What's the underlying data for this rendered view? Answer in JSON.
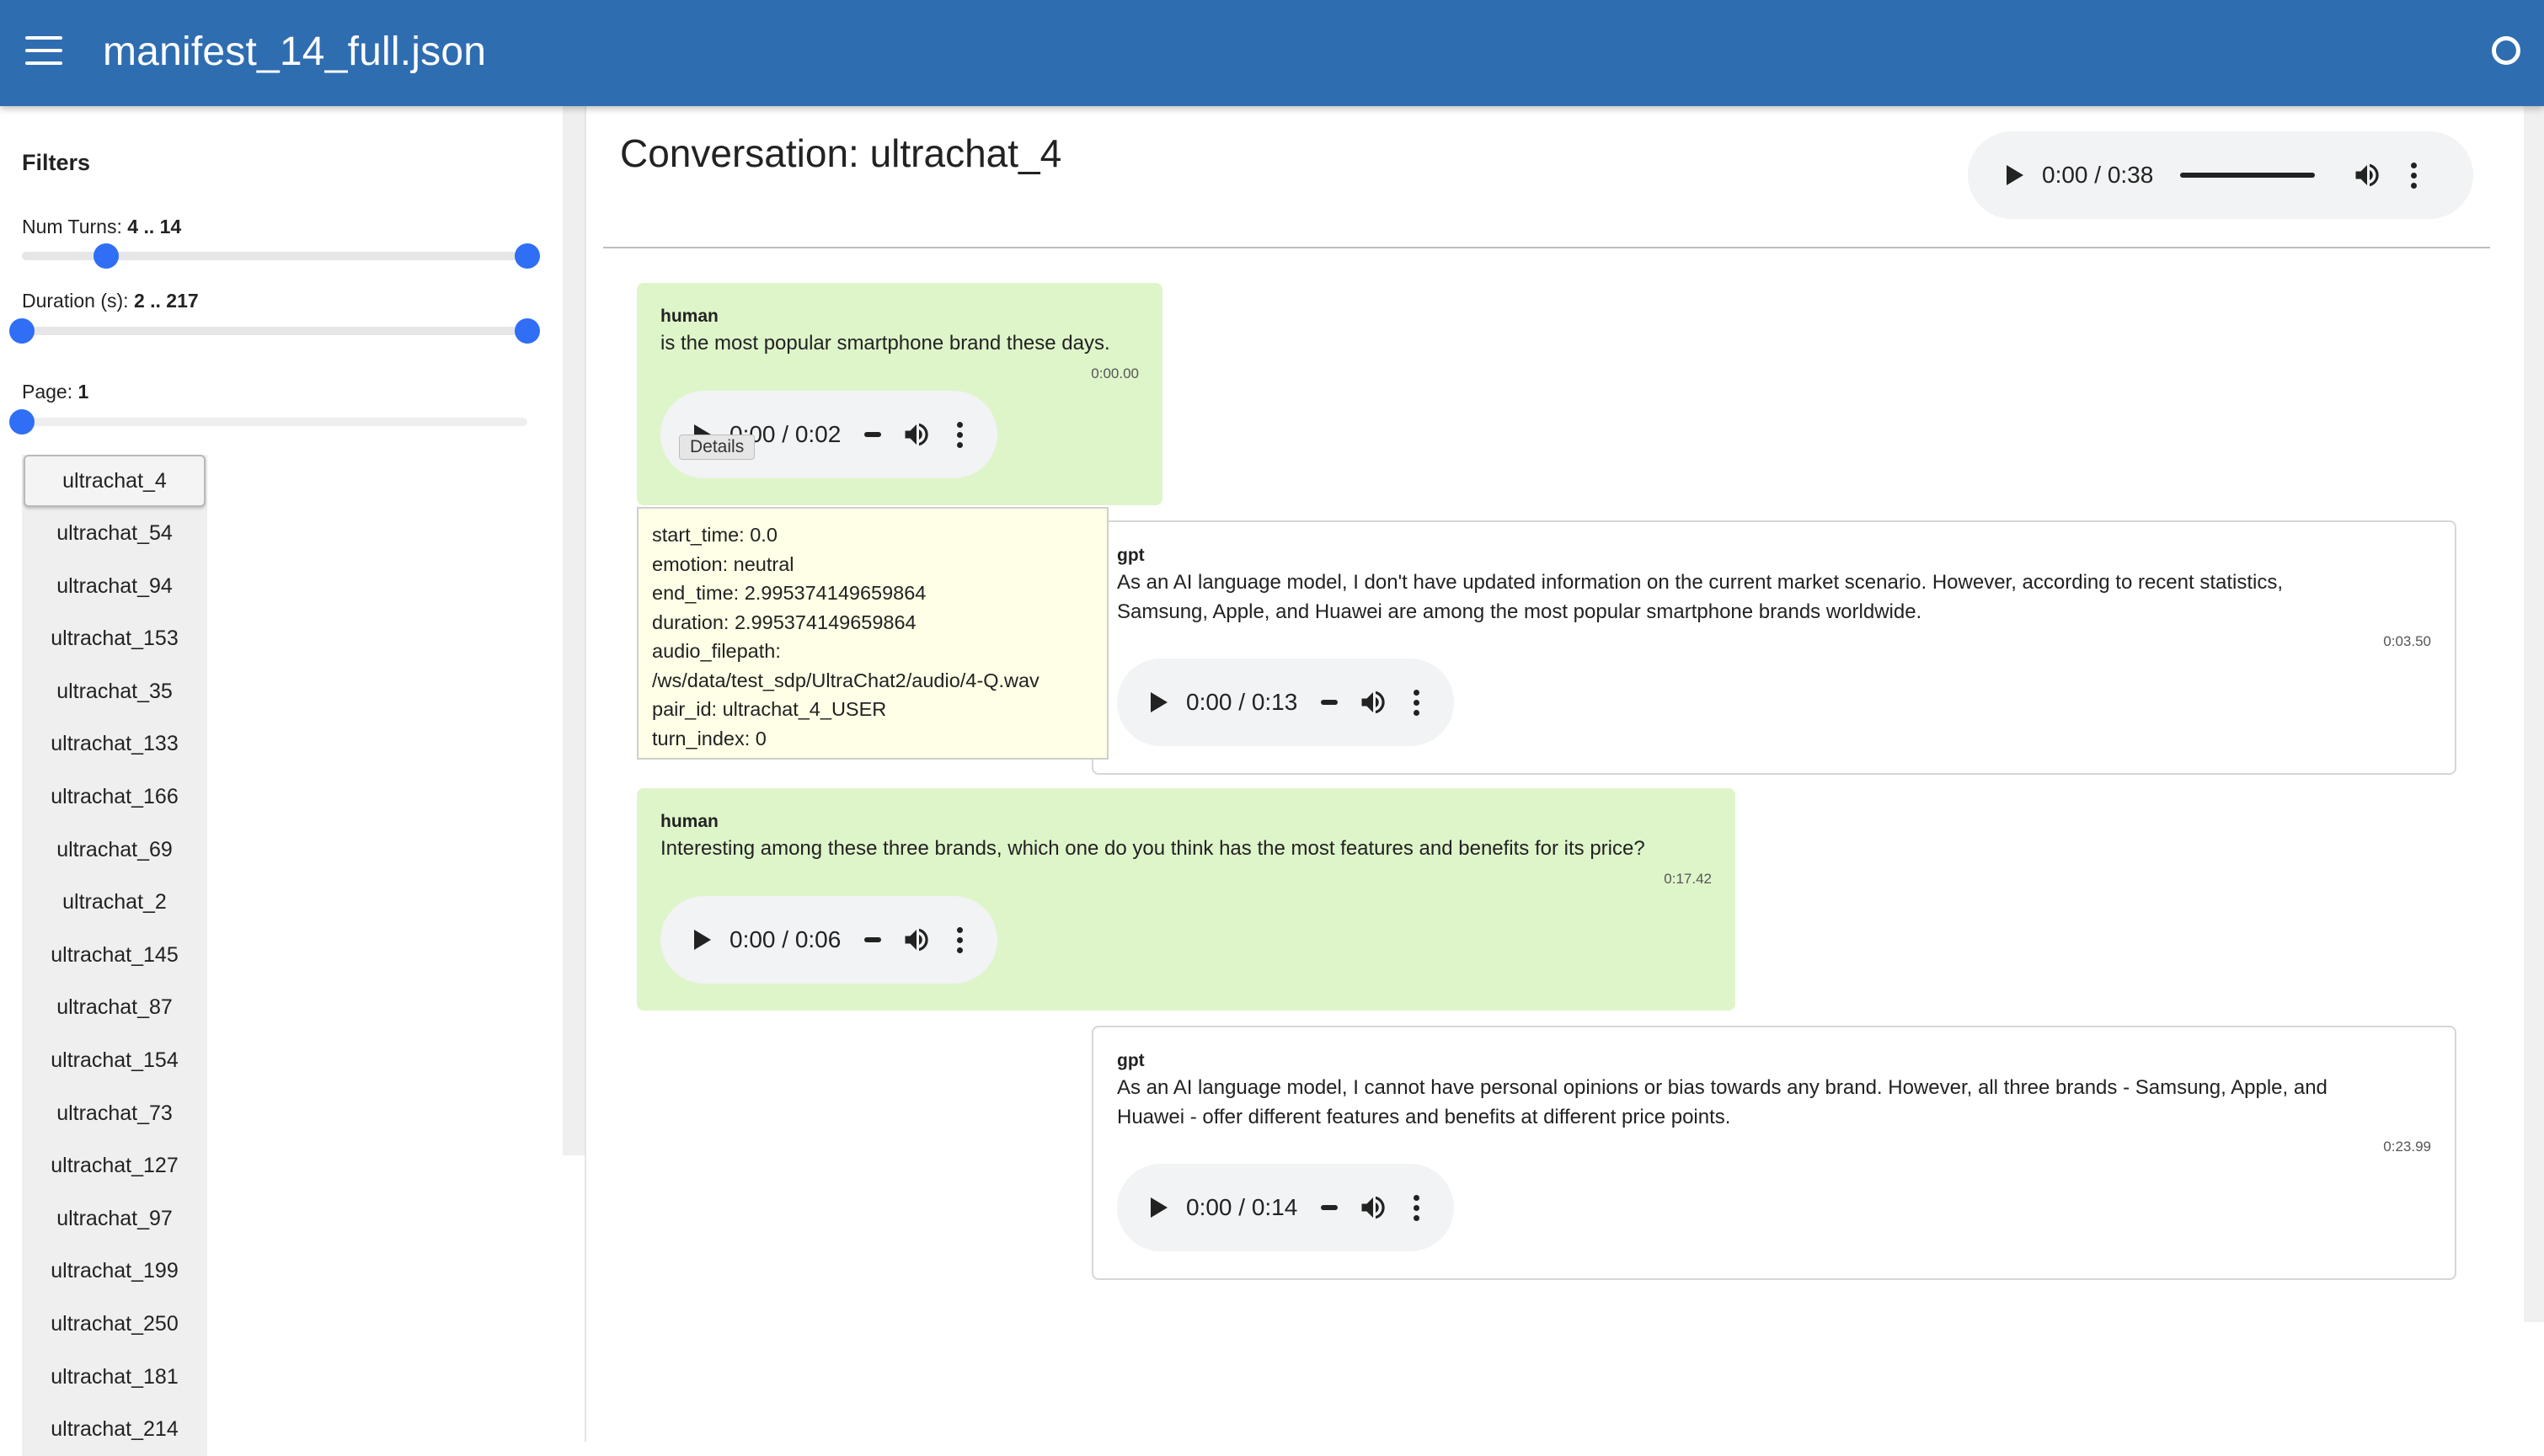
{
  "header": {
    "title": "manifest_14_full.json"
  },
  "sidebar": {
    "filters_title": "Filters",
    "num_turns": {
      "label": "Num Turns: ",
      "value": "4 .. 14",
      "min": 4,
      "max": 14
    },
    "duration": {
      "label": "Duration (s): ",
      "value": "2 .. 217",
      "min": 2,
      "max": 217
    },
    "page": {
      "label": "Page: ",
      "value": "1"
    },
    "conversations": [
      "ultrachat_4",
      "ultrachat_54",
      "ultrachat_94",
      "ultrachat_153",
      "ultrachat_35",
      "ultrachat_133",
      "ultrachat_166",
      "ultrachat_69",
      "ultrachat_2",
      "ultrachat_145",
      "ultrachat_87",
      "ultrachat_154",
      "ultrachat_73",
      "ultrachat_127",
      "ultrachat_97",
      "ultrachat_199",
      "ultrachat_250",
      "ultrachat_181",
      "ultrachat_214"
    ],
    "selected": "ultrachat_4"
  },
  "main": {
    "title": "Conversation: ultrachat_4",
    "full_audio": {
      "time": "0:00 / 0:38"
    },
    "details_tooltip": "Details",
    "details": [
      "start_time: 0.0",
      "emotion: neutral",
      "end_time: 2.995374149659864",
      "duration: 2.995374149659864",
      "audio_filepath:",
      "/ws/data/test_sdp/UltraChat2/audio/4-Q.wav",
      "pair_id: ultrachat_4_USER",
      "turn_index: 0"
    ],
    "messages": [
      {
        "role": "human",
        "text": "is the most popular smartphone brand these days.",
        "timestamp": "0:00.00",
        "audio_time": "0:00 / 0:02",
        "audio_time_visible": "0:00 / 0:02"
      },
      {
        "role": "gpt",
        "text_lines": [
          "As an AI language model, I don't have updated information on the current market scenario. However, according to recent statistics,",
          "Samsung, Apple, and Huawei are among the most popular smartphone brands worldwide."
        ],
        "timestamp": "0:03.50",
        "audio_time": "0:00 / 0:13"
      },
      {
        "role": "human",
        "text": "Interesting among these three brands, which one do you think has the most features and benefits for its price?",
        "timestamp": "0:17.42",
        "audio_time": "0:00 / 0:06"
      },
      {
        "role": "gpt",
        "text_lines": [
          "As an AI language model, I cannot have personal opinions or bias towards any brand. However, all three brands - Samsung, Apple, and",
          "Huawei - offer different features and benefits at different price points."
        ],
        "timestamp": "0:23.99",
        "audio_time": "0:00 / 0:14"
      }
    ]
  },
  "colors": {
    "appbar": "#2f6db1",
    "human_bubble": "#def5ca",
    "details_bg": "#fffee6",
    "slider_knob": "#2f6ef5"
  }
}
